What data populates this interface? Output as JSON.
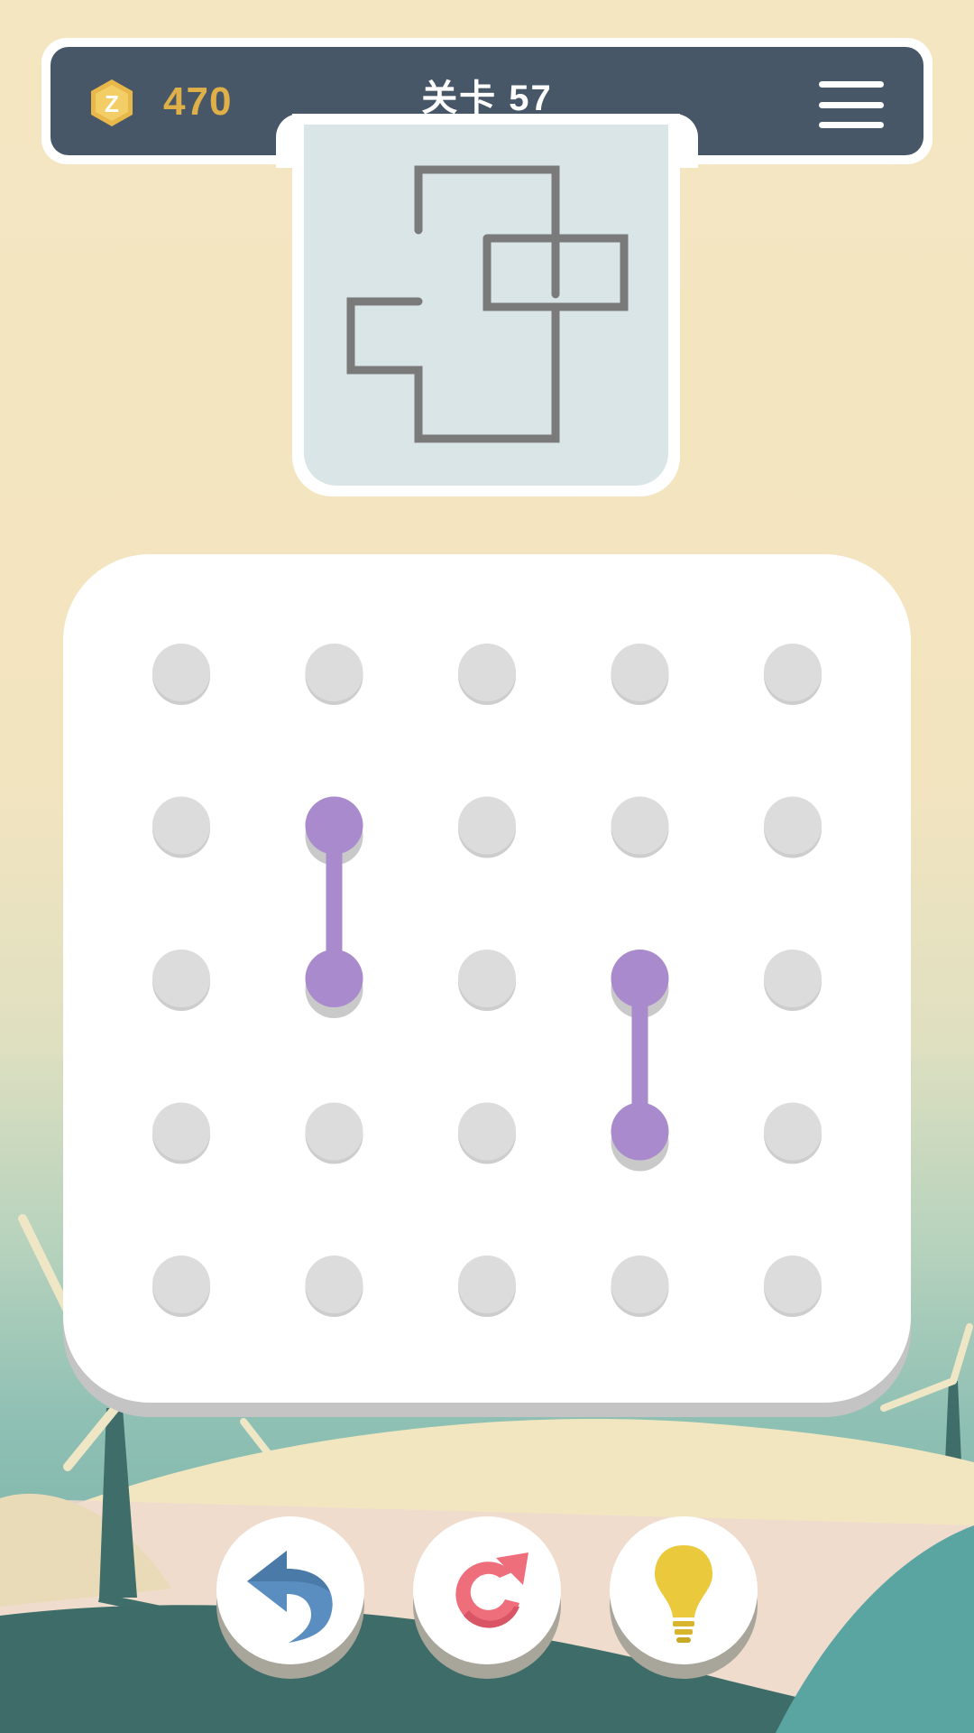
{
  "header": {
    "coin_icon": "coin-hexagon-icon",
    "coins": "470",
    "level_title": "关卡  57",
    "menu_icon": "hamburger-menu-icon"
  },
  "colors": {
    "header_bg": "#475767",
    "coin": "#e0b048",
    "preview_bg": "#d9e5e7",
    "preview_line": "#7a7a7a",
    "dot_idle": "#dcdcdc",
    "dot_active": "#a98bcd",
    "undo": "#5b8ec0",
    "restart": "#ef6e7c",
    "hint": "#eac93c"
  },
  "board": {
    "rows": 5,
    "cols": 5,
    "connected_segments": [
      {
        "from": [
          1,
          1
        ],
        "to": [
          2,
          1
        ]
      },
      {
        "from": [
          2,
          3
        ],
        "to": [
          3,
          3
        ]
      }
    ]
  },
  "target_pattern_icon": "target-shape-preview",
  "controls": {
    "undo_icon": "undo-arrow-icon",
    "restart_icon": "restart-arrow-icon",
    "hint_icon": "lightbulb-icon"
  }
}
